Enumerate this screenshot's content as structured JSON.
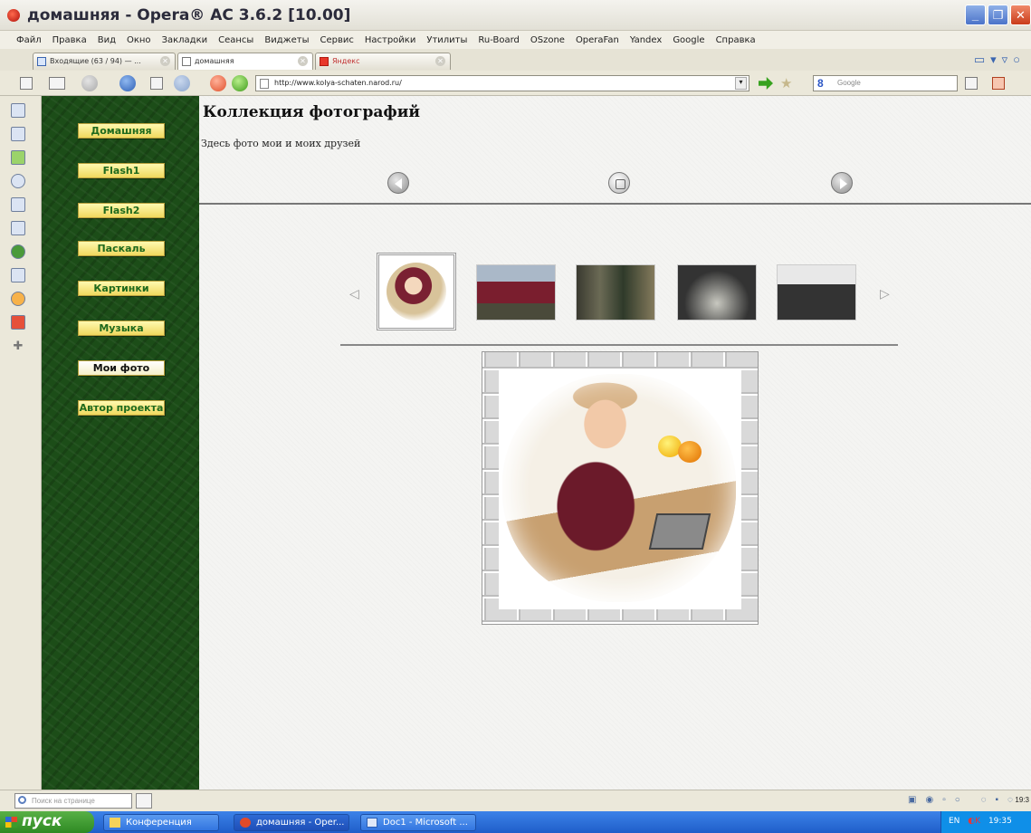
{
  "window": {
    "title": "домашняя - Opera® AC 3.6.2 [10.00]",
    "controls": [
      "_",
      "❐",
      "✕"
    ]
  },
  "menu": [
    "Файл",
    "Правка",
    "Вид",
    "Окно",
    "Закладки",
    "Сеансы",
    "Виджеты",
    "Сервис",
    "Настройки",
    "Утилиты",
    "Ru-Board",
    "OSzone",
    "OperaFan",
    "Yandex",
    "Google",
    "Справка"
  ],
  "tabs": [
    {
      "label": "Входящие (63 / 94) — ..."
    },
    {
      "label": "домашняя"
    },
    {
      "label": "Яндекс"
    }
  ],
  "address": {
    "url": "http://www.kolya-schaten.narod.ru/",
    "search_placeholder": "Google",
    "search_engine_icon": "8"
  },
  "nav": {
    "items": [
      "Домашняя",
      "Flash1",
      "Flash2",
      "Паскаль",
      "Картинки",
      "Музыка",
      "Мои фото",
      "Автор проекта"
    ],
    "active": "Мои фото"
  },
  "content": {
    "title": "Коллекция фотографий",
    "subtitle": "Здесь фото мои и моих друзей",
    "thumb_prev": "◁",
    "thumb_next": "▷"
  },
  "statusbar": {
    "find_placeholder": "Поиск на странице",
    "time_partial": "19:3"
  },
  "taskbar": {
    "start": "пуск",
    "tasks": [
      "Конференция",
      "домашняя - Oper...",
      "Doc1 - Microsoft ..."
    ],
    "lang": "EN",
    "time": "19:35"
  },
  "colors": {
    "nav_background": "#1c4d18",
    "nav_button": "#f0d85e",
    "nav_text": "#1f6a1d"
  }
}
